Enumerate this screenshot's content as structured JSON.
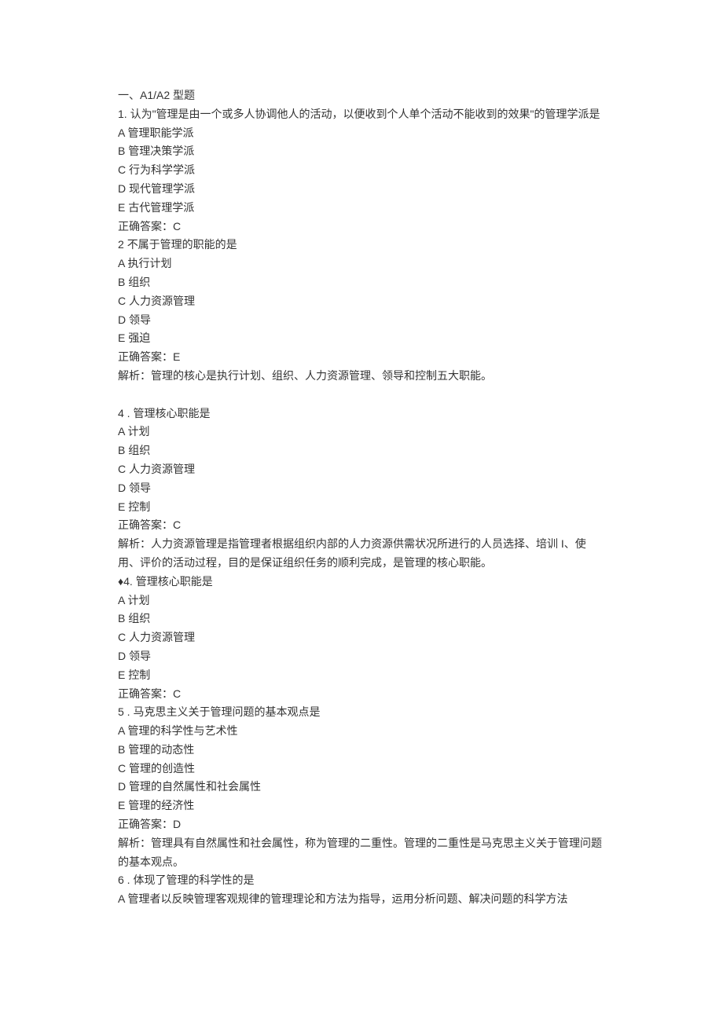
{
  "section_header": "一、A1/A2 型题",
  "questions": [
    {
      "number": "1.",
      "stem": "认为\"管理是由一个或多人协调他人的活动，以便收到个人单个活动不能收到的效果\"的管理学派是",
      "options": [
        "A 管理职能学派",
        "B 管理决策学派",
        "C 行为科学学派",
        "D 现代管理学派",
        "E 古代管理学派"
      ],
      "answer": "正确答案：C",
      "analysis": ""
    },
    {
      "number": "2",
      "stem": "不属于管理的职能的是",
      "options": [
        "A 执行计划",
        "B 组织",
        "C 人力资源管理",
        "D 领导",
        "E 强迫"
      ],
      "answer": "正确答案：E",
      "analysis": "解析：管理的核心是执行计划、组织、人力资源管理、领导和控制五大职能。"
    },
    {
      "number": "4  .",
      "stem": "管理核心职能是",
      "options": [
        "A 计划",
        "B 组织",
        "C 人力资源管理",
        "D 领导",
        "E 控制"
      ],
      "answer": "正确答案：C",
      "analysis": "解析：人力资源管理是指管理者根据组织内部的人力资源供需状况所进行的人员选择、培训 I、使用、评价的活动过程，目的是保证组织任务的顺利完成，是管理的核心职能。"
    },
    {
      "number": "♦4.",
      "stem": "管理核心职能是",
      "options": [
        "A 计划",
        "B 组织",
        "C 人力资源管理",
        "D 领导",
        "E 控制"
      ],
      "answer": "正确答案：C",
      "analysis": ""
    },
    {
      "number": "5  .",
      "stem": "马克思主义关于管理问题的基本观点是",
      "options": [
        "A 管理的科学性与艺术性",
        "B 管理的动态性",
        "C 管理的创造性",
        "D 管理的自然属性和社会属性",
        "E 管理的经济性"
      ],
      "answer": "正确答案：D",
      "analysis": "解析：管理具有自然属性和社会属性，称为管理的二重性。管理的二重性是马克思主义关于管理问题的基本观点。"
    },
    {
      "number": "6  .",
      "stem": "体现了管理的科学性的是",
      "options": [
        "A 管理者以反映管理客观规律的管理理论和方法为指导，运用分析问题、解决问题的科学方法"
      ],
      "answer": "",
      "analysis": ""
    }
  ]
}
